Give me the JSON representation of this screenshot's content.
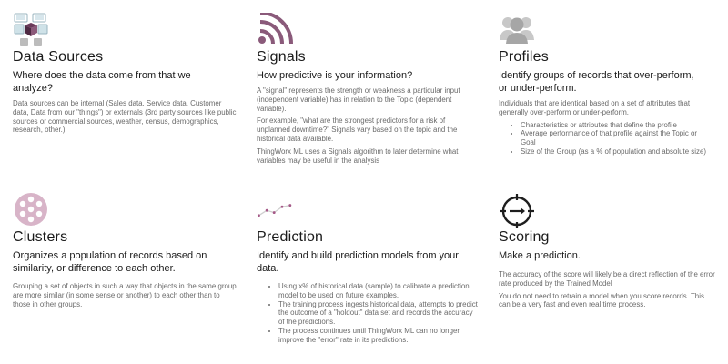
{
  "cards": {
    "data_sources": {
      "icon": "data-sources-icon",
      "title": "Data Sources",
      "subtitle": "Where does the data come from that we analyze?",
      "paragraphs": [
        "Data sources can be internal (Sales data, Service data, Customer data, Data from our \"things\") or externals (3rd party sources like public sources or commercial sources, weather, census, demographics, research, other.)"
      ]
    },
    "signals": {
      "icon": "signal-icon",
      "title": "Signals",
      "subtitle": "How predictive is your information?",
      "paragraphs": [
        "A \"signal\" represents the strength or weakness a particular input (independent variable) has in relation to the Topic (dependent variable).",
        "For example, \"what are the strongest predictors for a risk of unplanned downtime?\" Signals vary based on the topic and the historical data available.",
        "ThingWorx ML uses a Signals algorithm to later determine what variables may be useful in the analysis"
      ]
    },
    "profiles": {
      "icon": "people-icon",
      "title": "Profiles",
      "subtitle": "Identify groups of records that over-perform, or under-perform.",
      "paragraphs": [
        "Individuals that are identical based on a set of attributes that generally over-perform or under-perform."
      ],
      "bullets": [
        "Characteristics or attributes that define the profile",
        "Average performance of that profile against the Topic or Goal",
        "Size of the Group (as a % of population and absolute size)"
      ]
    },
    "clusters": {
      "icon": "cluster-icon",
      "title": "Clusters",
      "subtitle": "Organizes a population of records based on similarity, or difference to each other.",
      "paragraphs": [
        "Grouping a set of objects in such a way that objects in the same group are more similar (in some sense or another) to each other than to those in other groups."
      ]
    },
    "prediction": {
      "icon": "trend-line-icon",
      "title": "Prediction",
      "subtitle": "Identify and build prediction models from your data.",
      "bullets": [
        "Using x% of historical data (sample) to calibrate a prediction model to be used on future examples.",
        "The training process ingests historical data, attempts to predict the outcome of a \"holdout\" data set and records the accuracy of the predictions.",
        "The process continues until ThingWorx ML can no longer improve the \"error\" rate in its predictions."
      ]
    },
    "scoring": {
      "icon": "target-icon",
      "title": "Scoring",
      "subtitle": "Make a prediction.",
      "paragraphs": [
        "The accuracy of the score will likely be a direct reflection of the error rate produced by the Trained Model",
        "You do not need to retrain a model when you score records. This can be a very fast and even real time process."
      ]
    }
  }
}
